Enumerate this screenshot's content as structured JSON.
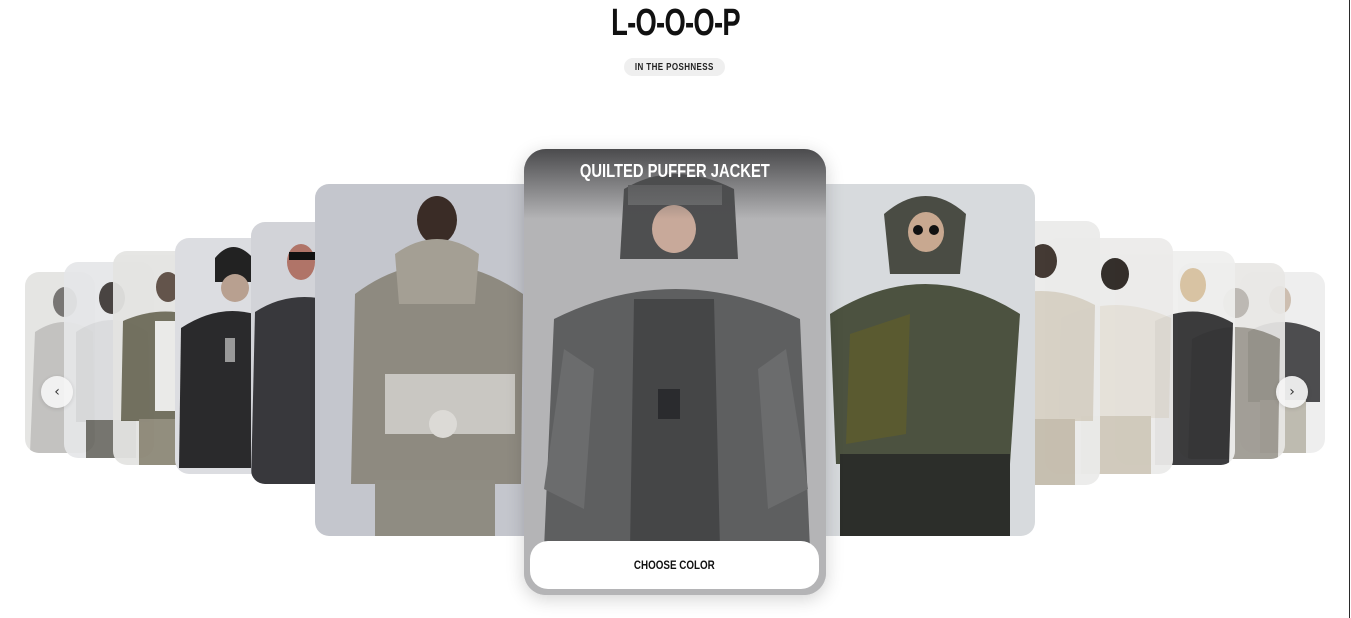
{
  "brand": {
    "title": "L-O-O-O-P",
    "tagline": "IN THE POSHNESS"
  },
  "carousel": {
    "featured": {
      "title": "QUILTED PUFFER JACKET",
      "button_label": "CHOOSE COLOR"
    },
    "prev_icon": "chevron-left-icon",
    "next_icon": "chevron-right-icon",
    "prev_glyph": "‹",
    "next_glyph": "›"
  },
  "colors": {
    "accent_button": "#ffffff",
    "title_text": "#111111",
    "tagline_bg": "#efefef"
  }
}
